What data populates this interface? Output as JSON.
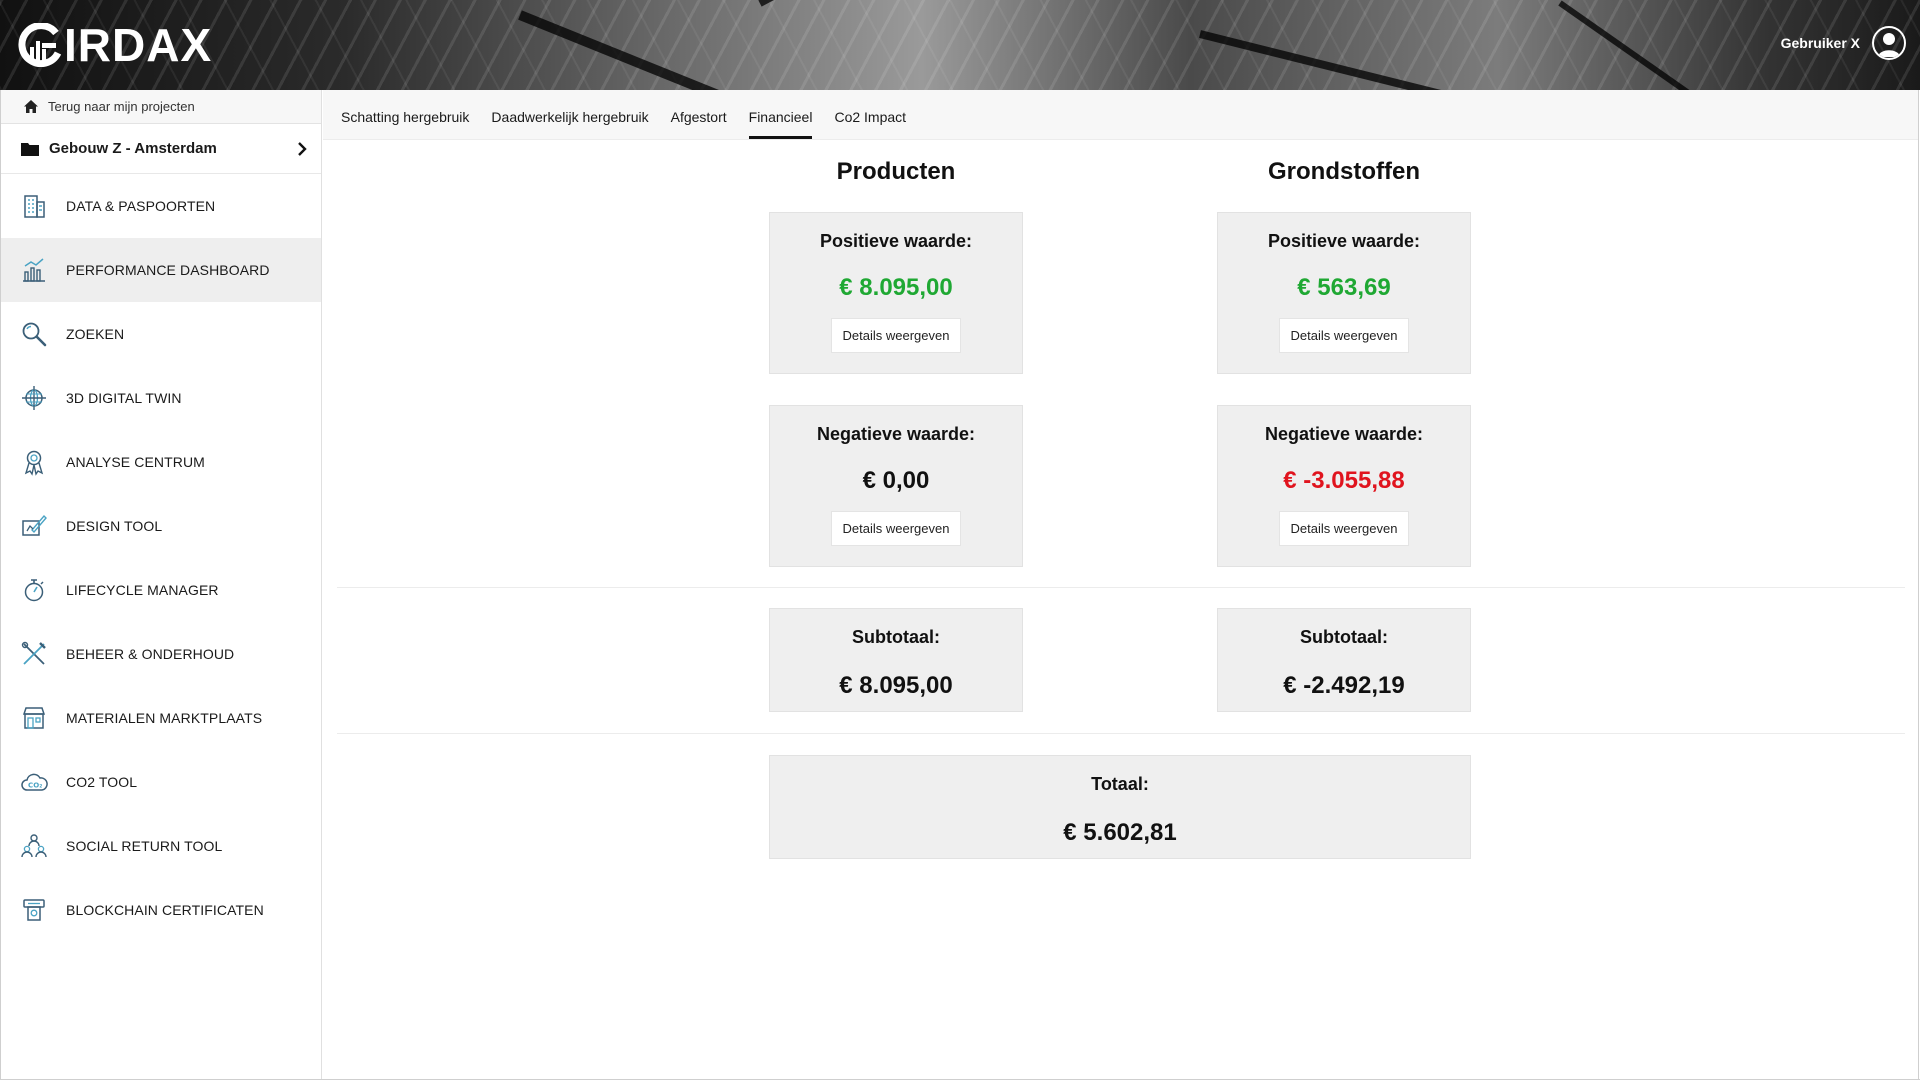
{
  "header": {
    "logo_text": "IRDAX",
    "user_name": "Gebruiker X"
  },
  "sidebar": {
    "back_link": "Terug naar mijn projecten",
    "project": "Gebouw Z - Amsterdam",
    "items": [
      {
        "label": "DATA & PASPOORTEN",
        "icon": "building-icon",
        "active": false
      },
      {
        "label": "PERFORMANCE DASHBOARD",
        "icon": "bar-chart-icon",
        "active": true
      },
      {
        "label": "ZOEKEN",
        "icon": "search-icon",
        "active": false
      },
      {
        "label": "3D DIGITAL TWIN",
        "icon": "globe-icon",
        "active": false
      },
      {
        "label": "ANALYSE CENTRUM",
        "icon": "award-icon",
        "active": false
      },
      {
        "label": "DESIGN TOOL",
        "icon": "design-icon",
        "active": false
      },
      {
        "label": "LIFECYCLE MANAGER",
        "icon": "stopwatch-icon",
        "active": false
      },
      {
        "label": "BEHEER & ONDERHOUD",
        "icon": "tools-icon",
        "active": false
      },
      {
        "label": "MATERIALEN MARKTPLAATS",
        "icon": "store-icon",
        "active": false
      },
      {
        "label": "CO2 TOOL",
        "icon": "co2-cloud-icon",
        "active": false
      },
      {
        "label": "SOCIAL RETURN TOOL",
        "icon": "people-icon",
        "active": false
      },
      {
        "label": "BLOCKCHAIN CERTIFICATEN",
        "icon": "certificate-icon",
        "active": false
      }
    ]
  },
  "tabs": [
    {
      "label": "Schatting hergebruik",
      "active": false
    },
    {
      "label": "Daadwerkelijk hergebruik",
      "active": false
    },
    {
      "label": "Afgestort",
      "active": false
    },
    {
      "label": "Financieel",
      "active": true
    },
    {
      "label": "Co2 Impact",
      "active": false
    }
  ],
  "financieel": {
    "producten": {
      "title": "Producten",
      "positive": {
        "label": "Positieve waarde:",
        "value": "€ 8.095,00",
        "button": "Details weergeven"
      },
      "negative": {
        "label": "Negatieve waarde:",
        "value": "€ 0,00",
        "button": "Details weergeven"
      },
      "subtotal": {
        "label": "Subtotaal:",
        "value": "€ 8.095,00"
      }
    },
    "grondstoffen": {
      "title": "Grondstoffen",
      "positive": {
        "label": "Positieve waarde:",
        "value": "€ 563,69",
        "button": "Details weergeven"
      },
      "negative": {
        "label": "Negatieve waarde:",
        "value": "€ -3.055,88",
        "button": "Details weergeven"
      },
      "subtotal": {
        "label": "Subtotaal:",
        "value": "€ -2.492,19"
      }
    },
    "total": {
      "label": "Totaal:",
      "value": "€ 5.602,81"
    }
  },
  "colors": {
    "positive": "#1fa833",
    "negative": "#e0141e",
    "neutral": "#111111"
  }
}
